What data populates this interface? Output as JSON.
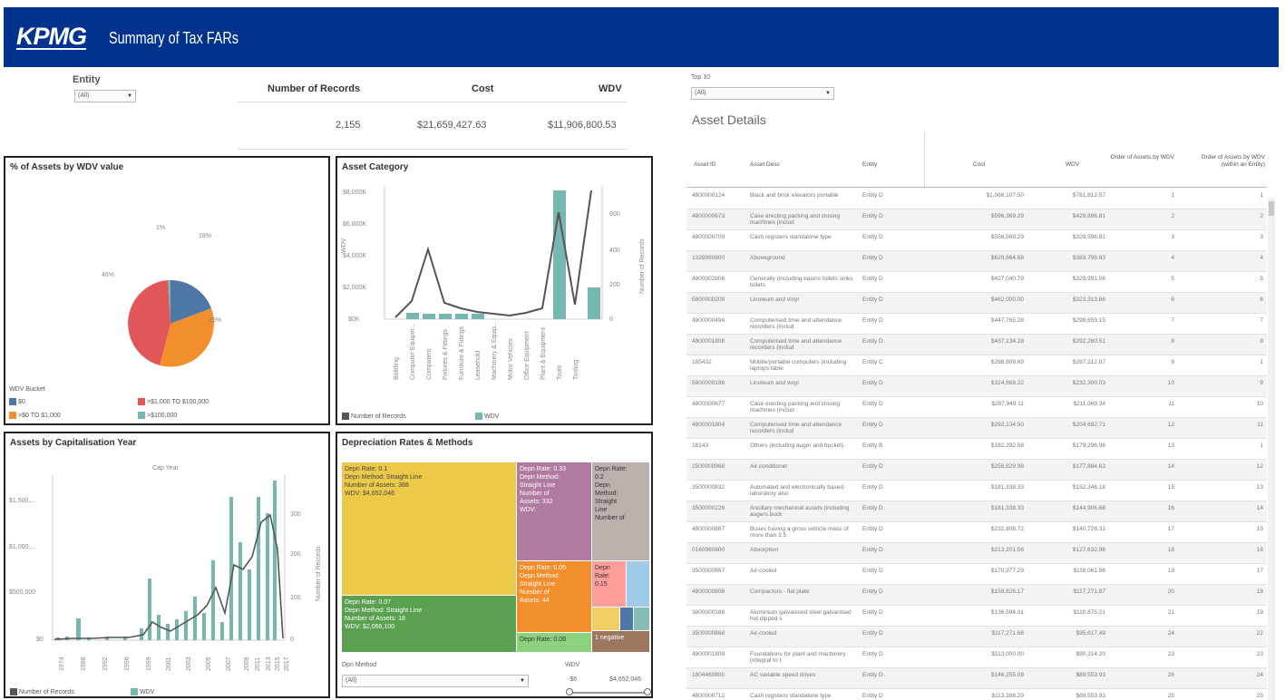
{
  "header": {
    "logo": "KPMG",
    "title": "Summary of Tax FARs",
    "bg": "#00338d"
  },
  "filters": {
    "entity_label": "Entity",
    "entity_value": "(All)",
    "top10_label": "Top 10",
    "top10_value": "(All)"
  },
  "kpis": {
    "headers": [
      "Number of Records",
      "Cost",
      "WDV"
    ],
    "values": [
      "2,155",
      "$21,659,427.63",
      "$11,906,800.53"
    ]
  },
  "pie": {
    "title": "% of Assets by WDV value",
    "legend_title": "WDV Bucket",
    "labels": [
      "1%",
      "18%",
      "35%",
      "46%"
    ],
    "legend": [
      {
        "label": "$0",
        "color": "#4e79a7"
      },
      {
        "label": ">$1,000 TO $100,000",
        "color": "#e15759"
      },
      {
        "label": ">$0 TO $1,000",
        "color": "#f28e2b"
      },
      {
        "label": ">$100,000",
        "color": "#76b7b2"
      }
    ]
  },
  "asset_category": {
    "title": "Asset Category",
    "y_label": "WDV",
    "y2_label": "Number of Records",
    "y_ticks": [
      "$8,000K",
      "$6,000K",
      "$4,000K",
      "$2,000K",
      "$0K"
    ],
    "y2_ticks": [
      "600",
      "400",
      "200",
      "0"
    ],
    "legend": [
      "Number of Records",
      "WDV"
    ]
  },
  "cap_year": {
    "title": "Assets by Capitalisation Year",
    "subtitle": "Cap Year",
    "y_ticks": [
      "$1,500,...",
      "$1,000,...",
      "$500,000",
      "$0"
    ],
    "y2_ticks": [
      "300",
      "200",
      "100",
      "0"
    ],
    "y2_label": "Number of Records",
    "legend": [
      "Number of Records",
      "WDV"
    ]
  },
  "depreciation": {
    "title": "Depreciation Rates & Methods",
    "method_label": "Dpn Method",
    "method_value": "(All)",
    "wdv_label": "WDV",
    "slider_min": "-$6",
    "slider_max": "$4,652,046",
    "cells": [
      {
        "lines": [
          "Depn Rate: 0.1",
          "Depn Method: Straight Line",
          "Number of Assets: 368",
          "WDV: $4,652,046"
        ]
      },
      {
        "lines": [
          "Depn Rate: 0.33",
          "Depn Method:",
          "Straight Line",
          "Number of",
          "Assets: 332",
          "WDV:"
        ]
      },
      {
        "lines": [
          "Depn Rate:",
          "0.2",
          "Depn",
          "Method:",
          "Straight",
          "Line",
          "Number of"
        ]
      },
      {
        "lines": [
          "Depn Rate: 0.07",
          "Depn Method: Straight Line",
          "Number of Assets: 18",
          "WDV: $2,066,100"
        ]
      },
      {
        "lines": [
          "Depn Rate: 0.05",
          "Depn Method:",
          "Straight Line",
          "Number of",
          "Assets: 44"
        ]
      },
      {
        "lines": [
          "Depn",
          "Rate:",
          "0.15"
        ]
      },
      {
        "lines": [
          "Depn Rate: 0.08"
        ]
      },
      {
        "lines": [
          "1 negative"
        ]
      }
    ]
  },
  "assets_table": {
    "title": "Asset Details",
    "headers": [
      "Asset ID",
      "Asset Desc",
      "Entity",
      "Cost",
      "WDV",
      "Order of Assets by WDV",
      "Order of Assets by WDV (within an Entity)"
    ],
    "rows": [
      [
        "4800000124",
        "Black and brick elevators portable",
        "Entity D",
        "$1,066,107.50",
        "$781,812.57",
        "1",
        "1"
      ],
      [
        "4800000673",
        "Case erecting packing and closing machines (includ",
        "Entity D",
        "$596,369.29",
        "$429,896.81",
        "2",
        "2"
      ],
      [
        "4800000709",
        "Cash registers standalone type",
        "Entity D",
        "$556,569.29",
        "$329,596.81",
        "3",
        "3"
      ],
      [
        "1329980800",
        "Aboveground",
        "Entity D",
        "$629,664.68",
        "$383,799.83",
        "4",
        "4"
      ],
      [
        "4800002806",
        "Generally (including basins toilets sinks toilets",
        "Entity D",
        "$427,040.79",
        "$329,991.56",
        "5",
        "5"
      ],
      [
        "5800000208",
        "Linoleum and vinyl",
        "Entity D",
        "$462,000.00",
        "$323,313.66",
        "6",
        "6"
      ],
      [
        "4800000494",
        "Computerised time and attendance recorders (includ",
        "Entity D",
        "$447,765.28",
        "$298,659.15",
        "7",
        "7"
      ],
      [
        "4800001808",
        "Computerised time and attendance recorders (includ",
        "Entity D",
        "$437,134.28",
        "$292,260.51",
        "8",
        "8"
      ],
      [
        "185432",
        "Mobile/portable computers (including laptops table",
        "Entity C",
        "$268,809.69",
        "$287,212.87",
        "9",
        "1"
      ],
      [
        "5800000198",
        "Linoleum and vinyl",
        "Entity D",
        "$324,868.22",
        "$232,300.03",
        "10",
        "9"
      ],
      [
        "4800000677",
        "Case erecting packing and closing machines (includ",
        "Entity D",
        "$287,949.11",
        "$211,069.34",
        "11",
        "10"
      ],
      [
        "4800001804",
        "Computerised time and attendance recorders (includ",
        "Entity D",
        "$292,134.50",
        "$204,692.71",
        "12",
        "11"
      ],
      [
        "18143",
        "Others (including auger and bucket)",
        "Entity B",
        "$182,292.58",
        "$179,296.96",
        "13",
        "1"
      ],
      [
        "2500000968",
        "Air conditioner",
        "Entity D",
        "$258,829.98",
        "$177,884.63",
        "14",
        "12"
      ],
      [
        "3500000832",
        "Automated and electronically based laboratory also",
        "Entity D",
        "$181,338.33",
        "$152,346.18",
        "15",
        "13"
      ],
      [
        "3500000226",
        "Ancillary mechanical assets (including augers buck",
        "Entity D",
        "$181,338.33",
        "$144,906.68",
        "16",
        "14"
      ],
      [
        "4800000867",
        "Buses having a gross vehicle mass of more than 3.5",
        "Entity D",
        "$232,808.72",
        "$140,726.31",
        "17",
        "15"
      ],
      [
        "0160960800",
        "Absorption",
        "Entity D",
        "$213,201.56",
        "$127,632.96",
        "18",
        "16"
      ],
      [
        "3500000867",
        "Air-cooled",
        "Entity D",
        "$170,977.29",
        "$118,061.96",
        "19",
        "17"
      ],
      [
        "4800000806",
        "Compactors - flat plate",
        "Entity D",
        "$159,826.17",
        "$117,271.87",
        "20",
        "18"
      ],
      [
        "3800000189",
        "Aluminium galvanised steel galvanised hot dipped s",
        "Entity D",
        "$136,594.01",
        "$110,875.21",
        "21",
        "19"
      ],
      [
        "3500000868",
        "Air-cooled",
        "Entity D",
        "$117,271.68",
        "$95,617.49",
        "24",
        "22"
      ],
      [
        "4800001809",
        "Foundations for plant and machinery (integral to t",
        "Entity D",
        "$113,000.00",
        "$90,314.20",
        "23",
        "23"
      ],
      [
        "1804480800",
        "AC variable speed drives",
        "Entity D",
        "$146,255.09",
        "$89,553.93",
        "26",
        "24"
      ],
      [
        "4800000712",
        "Cash registers standalone type",
        "Entity D",
        "$113,268.29",
        "$89,553.93",
        "25",
        "25"
      ]
    ]
  }
}
